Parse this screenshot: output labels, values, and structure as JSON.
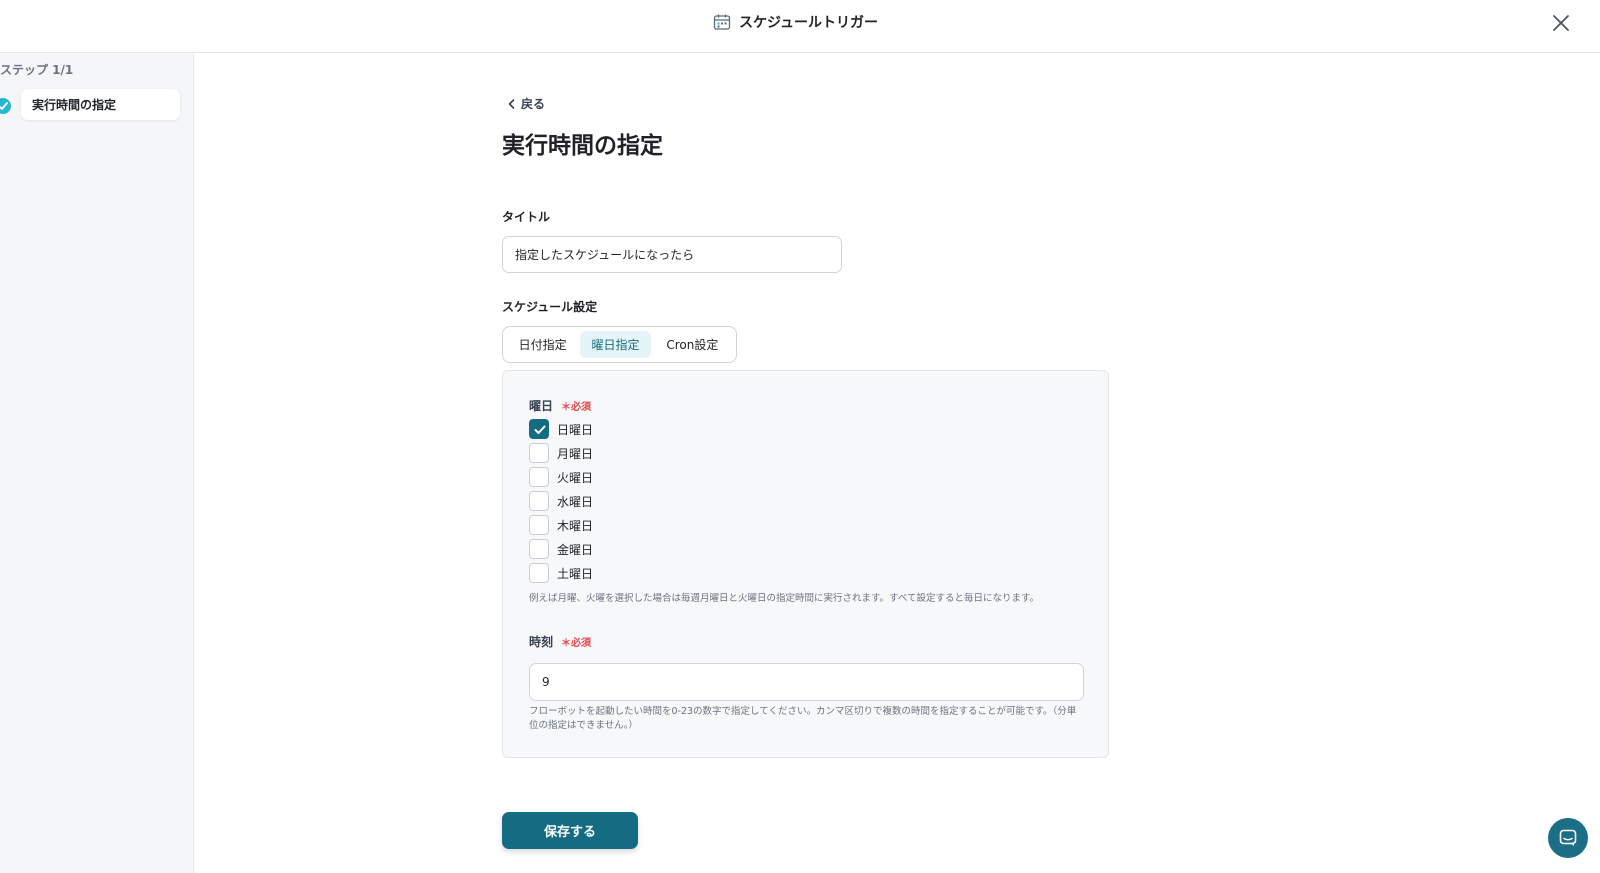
{
  "header": {
    "title": "スケジュールトリガー",
    "icon": "calendar-icon",
    "close_icon": "close-icon"
  },
  "sidebar": {
    "step_label": "ステップ 1/1",
    "items": [
      {
        "label": "実行時間の指定",
        "status": "completed"
      }
    ]
  },
  "main": {
    "back_label": "戻る",
    "page_title": "実行時間の指定",
    "title_field": {
      "label": "タイトル",
      "value": "指定したスケジュールになったら"
    },
    "schedule": {
      "label": "スケジュール設定",
      "tabs": [
        {
          "label": "日付指定",
          "active": false
        },
        {
          "label": "曜日指定",
          "active": true
        },
        {
          "label": "Cron設定",
          "active": false
        }
      ],
      "weekday": {
        "label": "曜日",
        "required": "＊必須",
        "options": [
          {
            "label": "日曜日",
            "checked": true
          },
          {
            "label": "月曜日",
            "checked": false
          },
          {
            "label": "火曜日",
            "checked": false
          },
          {
            "label": "水曜日",
            "checked": false
          },
          {
            "label": "木曜日",
            "checked": false
          },
          {
            "label": "金曜日",
            "checked": false
          },
          {
            "label": "土曜日",
            "checked": false
          }
        ],
        "hint": "例えば月曜、火曜を選択した場合は毎週月曜日と火曜日の指定時間に実行されます。すべて設定すると毎日になります。"
      },
      "time": {
        "label": "時刻",
        "required": "＊必須",
        "value": "9",
        "hint": "フローボットを起動したい時間を0-23の数字で指定してください。カンマ区切りで複数の時間を指定することが可能です。（分単位の指定はできません。）"
      }
    },
    "save_label": "保存する"
  },
  "colors": {
    "primary": "#156b82",
    "required": "#e5484d",
    "completed": "#28b5d1"
  }
}
